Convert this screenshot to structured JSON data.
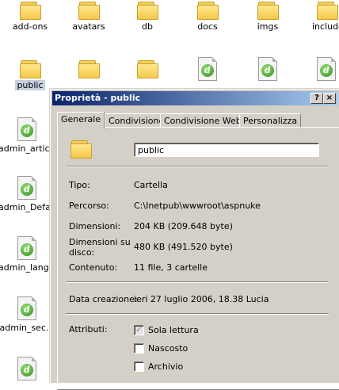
{
  "desktop": {
    "row1": [
      {
        "label": "add-ons",
        "type": "folder"
      },
      {
        "label": "avatars",
        "type": "folder"
      },
      {
        "label": "db",
        "type": "folder"
      },
      {
        "label": "docs",
        "type": "folder"
      },
      {
        "label": "imgs",
        "type": "folder"
      },
      {
        "label": "includes",
        "type": "folder"
      }
    ],
    "row2": [
      {
        "label": "public",
        "type": "folder"
      },
      {
        "label": "",
        "type": "folder"
      },
      {
        "label": "",
        "type": "folder"
      },
      {
        "label": "",
        "type": "dw-file"
      },
      {
        "label": "",
        "type": "dw-file"
      },
      {
        "label": "",
        "type": "dw-file"
      }
    ],
    "left_column": [
      "admin_artic...",
      "admin_Defa...",
      "admin_lang...",
      "admin_sec..."
    ]
  },
  "dialog": {
    "title": "Proprietà - public",
    "help_button": "?",
    "close_button": "×",
    "tabs": [
      "Generale",
      "Condivisione",
      "Condivisione Web",
      "Personalizza"
    ],
    "active_tab": "Generale",
    "name": "public",
    "props": {
      "tipo_label": "Tipo:",
      "tipo_value": "Cartella",
      "percorso_label": "Percorso:",
      "percorso_value": "C:\\Inetpub\\wwwroot\\aspnuke",
      "dimensioni_label": "Dimensioni:",
      "dimensioni_value": "204 KB (209.648 byte)",
      "disco_label": "Dimensioni su disco:",
      "disco_value": "480 KB (491.520 byte)",
      "contenuto_label": "Contenuto:",
      "contenuto_value": "11 file, 3 cartelle",
      "creazione_label": "Data creazione:",
      "creazione_value": "ieri 27 luglio 2006, 18.38  Lucia"
    },
    "attributi": {
      "label": "Attributi:",
      "sola_lettura": "Sola lettura",
      "nascosto": "Nascosto",
      "archivio": "Archivio"
    }
  }
}
